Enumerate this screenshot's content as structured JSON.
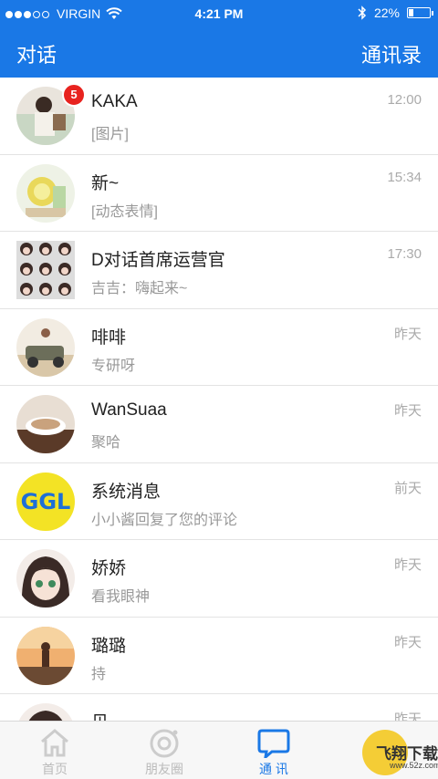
{
  "status_bar": {
    "carrier": "VIRGIN",
    "time": "4:21 PM",
    "battery": "22%",
    "battery_level": 0.22
  },
  "header": {
    "title": "对话",
    "contacts": "通讯录"
  },
  "conversations": [
    {
      "name": "KAKA",
      "message": "[图片]",
      "time": "12:00",
      "badge": "5"
    },
    {
      "name": "新~",
      "message": "[动态表情]",
      "time": "15:34"
    },
    {
      "name": "D对话首席运营官",
      "message": "吉吉：嗨起来~",
      "time": "17:30"
    },
    {
      "name": "啡啡",
      "message": "专研呀",
      "time": "昨天"
    },
    {
      "name": "WanSuaa",
      "message": "聚哈",
      "time": "昨天"
    },
    {
      "name": "系统消息",
      "message": "小小酱回复了您的评论",
      "time": "前天",
      "avatar_text": "GGL"
    },
    {
      "name": "娇娇",
      "message": "看我眼神",
      "time": "昨天"
    },
    {
      "name": "璐璐",
      "message": "持",
      "time": "昨天"
    },
    {
      "name": "贝",
      "message": "",
      "time": "昨天"
    }
  ],
  "tabs": [
    {
      "label": "首页"
    },
    {
      "label": "朋友圈"
    },
    {
      "label": "通  讯"
    },
    {
      "label": ""
    }
  ],
  "watermark": {
    "text": "飞翔下载",
    "sub": "www.52z.com"
  },
  "colors": {
    "brand_blue": "#1a78e6",
    "badge_red": "#e8231f"
  }
}
